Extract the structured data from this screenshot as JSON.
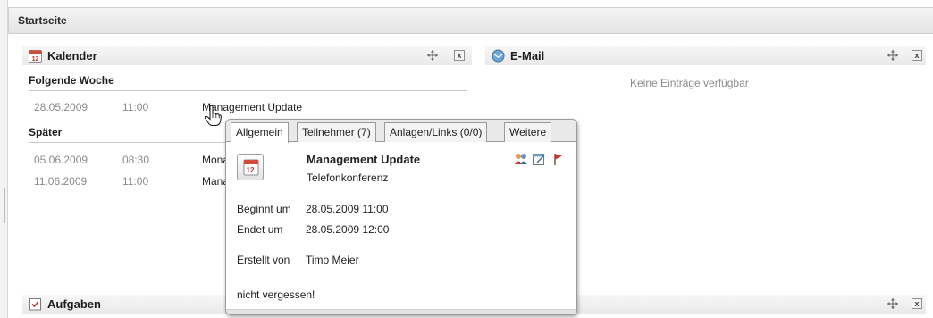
{
  "page": {
    "title": "Startseite"
  },
  "calendar": {
    "title": "Kalender",
    "icon": "calendar-icon",
    "section_next": "Folgende Woche",
    "section_later": "Später",
    "next_rows": [
      {
        "date": "28.05.2009",
        "time": "11:00",
        "subject": "Management Update"
      }
    ],
    "later_rows": [
      {
        "date": "05.06.2009",
        "time": "08:30",
        "subject": "Mona"
      },
      {
        "date": "11.06.2009",
        "time": "11:00",
        "subject": "Mana"
      }
    ]
  },
  "email": {
    "title": "E-Mail",
    "icon": "email-icon",
    "empty_message": "Keine Einträge verfügbar"
  },
  "tasks": {
    "title": "Aufgaben",
    "icon": "tasks-icon"
  },
  "controls": {
    "close_label": "x"
  },
  "popup": {
    "tabs": [
      "Allgemein",
      "Teilnehmer (7)",
      "Anlagen/Links (0/0)",
      "Weitere"
    ],
    "title": "Management Update",
    "subtitle": "Telefonkonferenz",
    "begin_label": "Beginnt um",
    "begin_value": "28.05.2009 11:00",
    "end_label": "Endet um",
    "end_value": "28.05.2009 12:00",
    "created_label": "Erstellt von",
    "created_value": "Timo Meier",
    "note": "nicht vergessen!",
    "calendar_day": "12"
  },
  "colors": {
    "accent_red": "#c0392b",
    "header_grey": "#e6e6e6",
    "muted_text": "#8a8a8a"
  }
}
